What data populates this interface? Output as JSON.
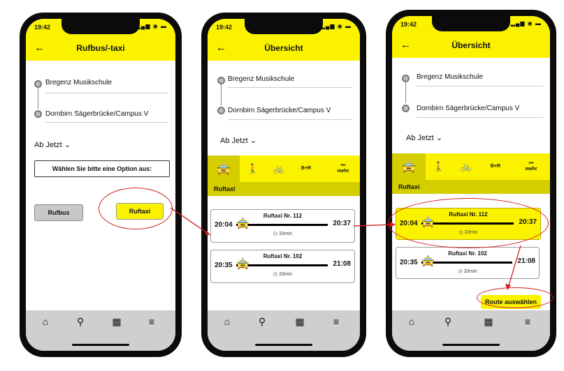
{
  "colors": {
    "brand_yellow": "#fbf200",
    "tab_active": "#d4ce00",
    "annotation_red": "#d21d1d",
    "nav_bg": "#cfcfcf"
  },
  "status": {
    "time": "19:42",
    "icons": "signal-wifi-battery"
  },
  "screen1": {
    "title": "Rufbus/-taxi",
    "stop_a": "Bregenz Musikschule",
    "stop_b": "Dornbirn Sägerbrücke/Campus V",
    "departure": "Ab Jetzt",
    "option_prompt": "Wählen Sie bitte eine Option aus:",
    "btn_rufbus": "Rufbus",
    "btn_ruftaxi": "Ruftaxi"
  },
  "screen2": {
    "title": "Übersicht",
    "stop_a": "Bregenz Musikschule",
    "stop_b": "Dornbirn Sägerbrücke/Campus V",
    "departure": "Ab Jetzt",
    "tabs": [
      "B+R",
      "mehr"
    ],
    "subhead": "Ruftaxi",
    "cards": [
      {
        "title": "Ruftaxi Nr. 112",
        "dep": "20:04",
        "arr": "20:37",
        "dur": "33min"
      },
      {
        "title": "Ruftaxi Nr. 102",
        "dep": "20:35",
        "arr": "21:08",
        "dur": "33min"
      }
    ]
  },
  "screen3": {
    "title": "Übersicht",
    "stop_a": "Bregenz Musikschule",
    "stop_b": "Dornbirn Sägerbrücke/Campus V",
    "departure": "Ab Jetzt",
    "tabs": [
      "B+R",
      "mehr"
    ],
    "subhead": "Ruftaxi",
    "cards": [
      {
        "title": "Ruftaxi Nr. 112",
        "dep": "20:04",
        "arr": "20:37",
        "dur": "33min"
      },
      {
        "title": "Ruftaxi Nr. 102",
        "dep": "20:35",
        "arr": "21:08",
        "dur": "33min"
      }
    ],
    "route_button": "Route auswählen"
  }
}
